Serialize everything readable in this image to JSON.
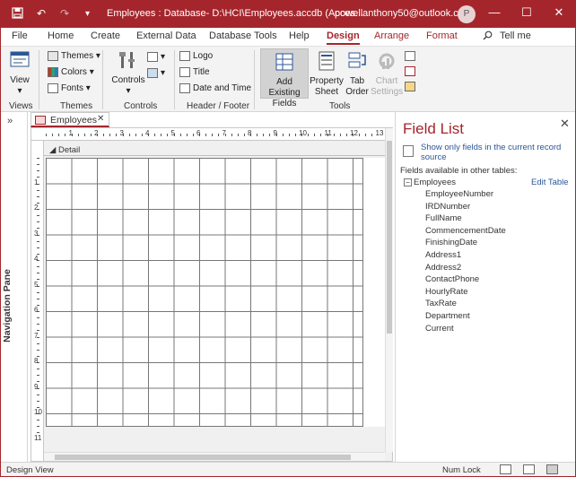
{
  "window": {
    "title": "Employees : Database- D:\\HCI\\Employees.accdb (Acces...",
    "account": "powellanthony50@outlook.com",
    "avatar_initial": "P",
    "minimize": "—",
    "maximize": "☐",
    "close": "✕"
  },
  "quick_access": {
    "save_glyph": "💾",
    "undo_glyph": "↶",
    "redo_glyph": "↷",
    "customize_glyph": "▾"
  },
  "menu": {
    "file": "File",
    "home": "Home",
    "create": "Create",
    "external_data": "External Data",
    "database_tools": "Database Tools",
    "help": "Help",
    "design": "Design",
    "arrange": "Arrange",
    "format": "Format",
    "tell_me": "Tell me",
    "tell_me_icon": "🔍"
  },
  "ribbon": {
    "views": {
      "view_label": "View",
      "group": "Views"
    },
    "themes": {
      "themes_label": "Themes",
      "colors_label": "Colors",
      "fonts_label": "Fonts",
      "group": "Themes"
    },
    "controls": {
      "controls_label": "Controls",
      "group": "Controls"
    },
    "header_footer": {
      "logo_label": "Logo",
      "title_label": "Title",
      "datetime_label": "Date and Time",
      "group": "Header / Footer"
    },
    "tools": {
      "add_fields_line1": "Add Existing",
      "add_fields_line2": "Fields",
      "property_line1": "Property",
      "property_line2": "Sheet",
      "taborder_line1": "Tab",
      "taborder_line2": "Order",
      "chart_line1": "Chart",
      "chart_line2": "Settings",
      "group": "Tools"
    },
    "dropdown_glyph": "▾"
  },
  "navigation": {
    "label": "Navigation Pane",
    "expand_glyph": "»"
  },
  "document_tab": {
    "label": "Employees",
    "close_glyph": "✕"
  },
  "design_surface": {
    "section_label": "Detail",
    "section_glyph": "◢",
    "hruler_labels": [
      "1",
      "2",
      "3",
      "4",
      "5",
      "6",
      "7",
      "8",
      "9",
      "10",
      "11",
      "12",
      "13"
    ],
    "vruler_labels": [
      "1",
      "2",
      "3",
      "4",
      "5",
      "6",
      "7",
      "8",
      "9",
      "10",
      "11"
    ]
  },
  "field_list": {
    "title": "Field List",
    "close_glyph": "✕",
    "show_only_text": "Show only fields in the current record source",
    "available_text": "Fields available in other tables:",
    "expander_glyph": "−",
    "table_name": "Employees",
    "edit_table": "Edit Table",
    "fields": [
      "EmployeeNumber",
      "IRDNumber",
      "FullName",
      "CommencementDate",
      "FinishingDate",
      "Address1",
      "Address2",
      "ContactPhone",
      "HourlyRate",
      "TaxRate",
      "Department",
      "Current"
    ]
  },
  "status_bar": {
    "view": "Design View",
    "num_lock": "Num Lock"
  }
}
